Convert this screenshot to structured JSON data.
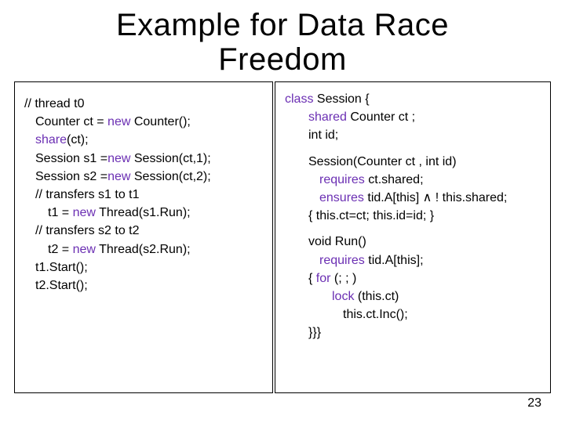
{
  "title_line1": "Example for Data Race",
  "title_line2": "Freedom",
  "left": {
    "l0": "// thread t0",
    "l1a": "Counter ct = ",
    "l1b": "new",
    "l1c": " Counter();",
    "l2a": "share",
    "l2b": "(ct);",
    "l3a": "Session s1 =",
    "l3b": "new",
    "l3c": " Session(ct,1);",
    "l4a": "Session s2 =",
    "l4b": "new",
    "l4c": " Session(ct,2);",
    "l5": "// transfers s1 to t1",
    "l6a": "t1 = ",
    "l6b": "new",
    "l6c": " Thread(s1.Run);",
    "l7": "// transfers s2 to t2",
    "l8a": "t2 = ",
    "l8b": "new",
    "l8c": " Thread(s2.Run);",
    "l9": "t1.Start();",
    "l10": "t2.Start();"
  },
  "right": {
    "r0a": "class",
    "r0b": " Session {",
    "r1a": "shared",
    "r1b": " Counter ct ;",
    "r2": "int id;",
    "r3": "Session(Counter ct , int id)",
    "r4a": "requires",
    "r4b": " ct.shared;",
    "r5a": "ensures",
    "r5b": " tid.A[this] ∧ ! this.shared;",
    "r6": "{ this.ct=ct; this.id=id; }",
    "r7": "void Run()",
    "r8a": "requires",
    "r8b": " tid.A[this];",
    "r9a": "{ ",
    "r9b": "for",
    "r9c": " (; ; )",
    "r10a": "lock",
    "r10b": " (this.ct)",
    "r11": "this.ct.Inc();",
    "r12": "}}}"
  },
  "pagenum": "23"
}
